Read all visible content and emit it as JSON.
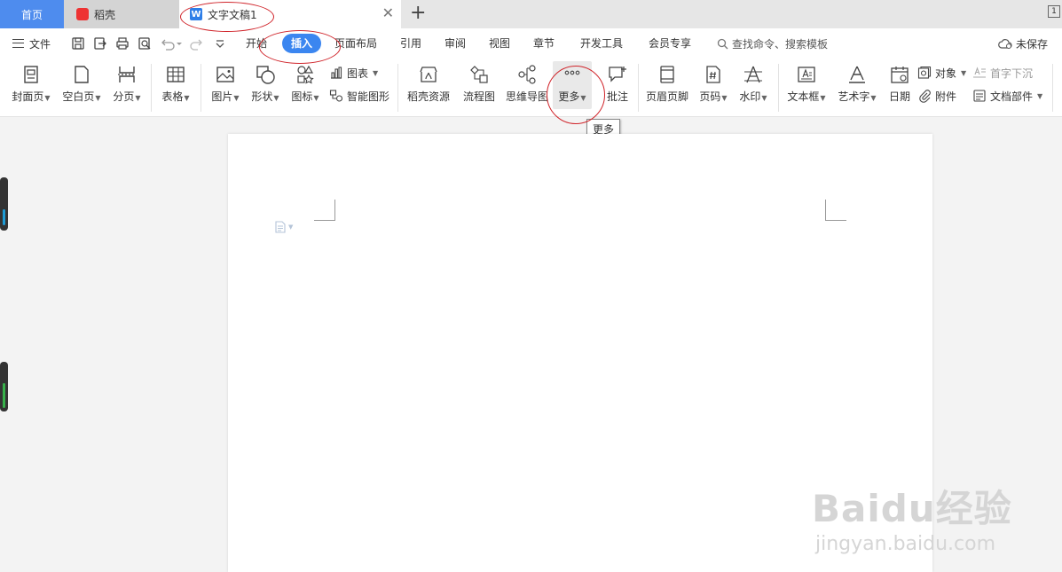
{
  "tabs": {
    "home": "首页",
    "daoke": "稻壳",
    "document": "文字文稿1",
    "add": "+",
    "window_indicator": "1"
  },
  "menu": {
    "file": "文件",
    "tabs": [
      "开始",
      "插入",
      "页面布局",
      "引用",
      "审阅",
      "视图",
      "章节",
      "开发工具",
      "会员专享"
    ],
    "active_tab": "插入",
    "search_placeholder": "查找命令、搜索模板",
    "save_status": "未保存"
  },
  "ribbon": {
    "cover": "封面页",
    "blank_page": "空白页",
    "page_break": "分页",
    "table": "表格",
    "picture": "图片",
    "shape": "形状",
    "icon": "图标",
    "chart": "图表",
    "smart_art": "智能图形",
    "daoke_resources": "稻壳资源",
    "flowchart": "流程图",
    "mindmap": "思维导图",
    "more": "更多",
    "comment": "批注",
    "header_footer": "页眉页脚",
    "page_number": "页码",
    "watermark": "水印",
    "textbox": "文本框",
    "wordart": "艺术字",
    "date": "日期",
    "object": "对象",
    "attachment": "附件",
    "dropcap": "首字下沉",
    "doc_parts": "文档部件"
  },
  "tooltip": "更多",
  "watermark": {
    "main": "Baidu经验",
    "sub": "jingyan.baidu.com"
  },
  "colors": {
    "accent": "#3b86f0",
    "home_tab": "#4e8cee",
    "annotation": "#d0242a",
    "daoke_logo": "#e33333"
  }
}
